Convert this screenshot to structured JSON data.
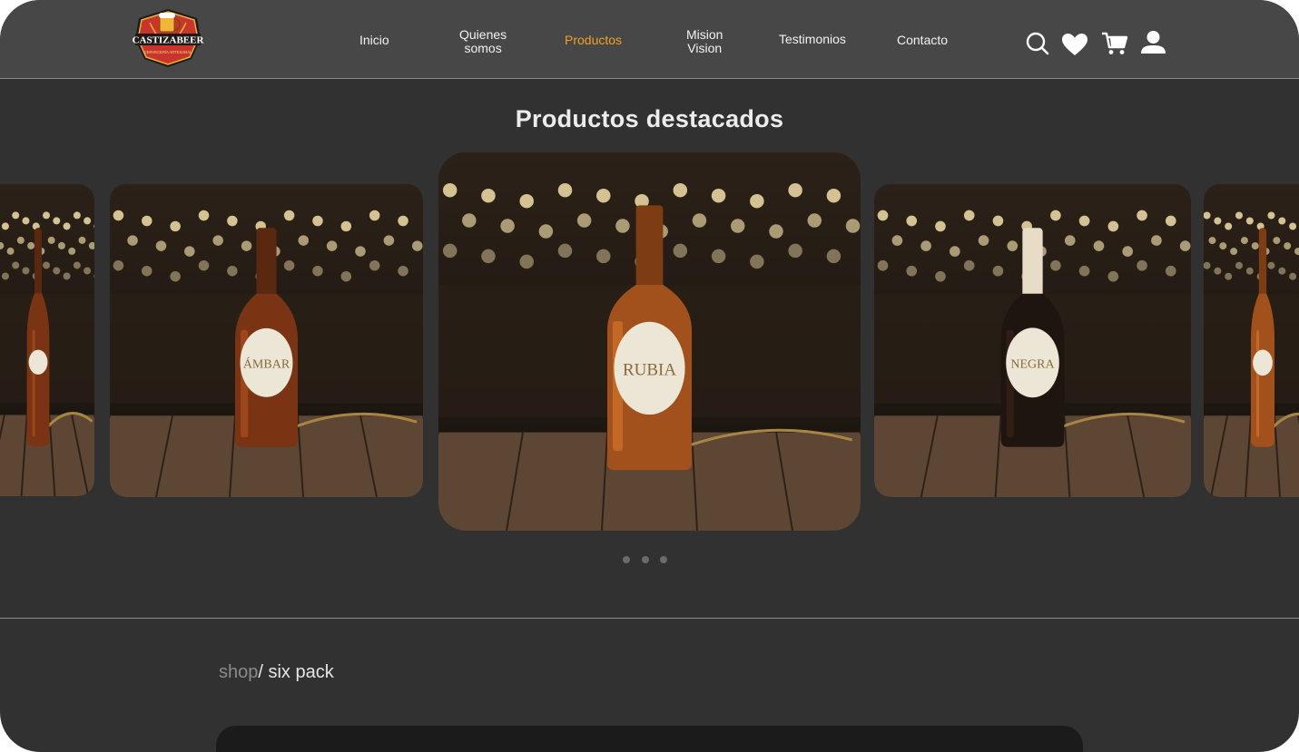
{
  "brand": {
    "name": "CASTIZABEER",
    "tagline": "CERVECERÍA ARTESANAL"
  },
  "nav": {
    "items": [
      {
        "id": "inicio",
        "lines": [
          "Inicio"
        ]
      },
      {
        "id": "quienes",
        "lines": [
          "Quienes",
          "somos"
        ]
      },
      {
        "id": "productos",
        "lines": [
          "Productos"
        ],
        "active": true
      },
      {
        "id": "mision",
        "lines": [
          "Mision",
          "Vision"
        ]
      },
      {
        "id": "testimonios",
        "lines": [
          "Testimonios"
        ]
      },
      {
        "id": "contacto",
        "lines": [
          "Contacto"
        ]
      }
    ],
    "icons": [
      "search-icon",
      "heart-icon",
      "cart-icon",
      "user-icon"
    ]
  },
  "featured": {
    "title": "Productos destacados",
    "cards": [
      {
        "label": "",
        "beer": "amber"
      },
      {
        "label": "ÁMBAR",
        "beer": "amber"
      },
      {
        "label": "RUBIA",
        "beer": "blonde"
      },
      {
        "label": "NEGRA",
        "beer": "dark"
      },
      {
        "label": "",
        "beer": "blonde"
      }
    ],
    "dots": 3
  },
  "breadcrumb": {
    "shop": "shop",
    "current": "/ six pack"
  },
  "colors": {
    "accent": "#f0a21e",
    "header_bg": "#474747",
    "page_bg": "#313131"
  }
}
